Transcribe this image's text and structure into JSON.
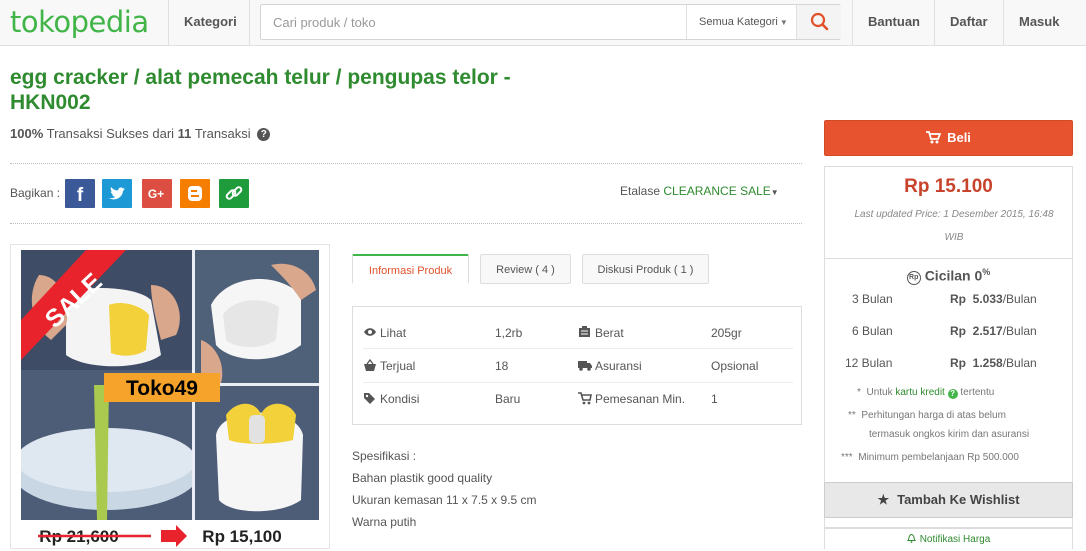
{
  "header": {
    "logo": "tokopedia",
    "kategori": "Kategori",
    "search_placeholder": "Cari produk / toko",
    "search_category": "Semua Kategori",
    "bantuan": "Bantuan",
    "daftar": "Daftar",
    "masuk": "Masuk"
  },
  "product": {
    "title_line1": "egg cracker / alat pemecah telur / pengupas telor -",
    "title_line2": "HKN002",
    "success_pct": "100%",
    "success_text": "Transaksi Sukses dari",
    "success_count": "11",
    "success_suffix": "Transaksi"
  },
  "share": {
    "label": "Bagikan :",
    "etalase_label": "Etalase",
    "etalase_value": "CLEARANCE SALE"
  },
  "image": {
    "sale_text": "SALE",
    "shop_label": "Toko49",
    "old_price": "Rp 21,600",
    "new_price": "Rp 15,100"
  },
  "tabs": {
    "info": "Informasi Produk",
    "review": "Review ( 4 )",
    "diskusi": "Diskusi Produk ( 1 )"
  },
  "info": {
    "lihat_label": "Lihat",
    "lihat_value": "1,2rb",
    "berat_label": "Berat",
    "berat_value": "205gr",
    "terjual_label": "Terjual",
    "terjual_value": "18",
    "asuransi_label": "Asuransi",
    "asuransi_value": "Opsional",
    "kondisi_label": "Kondisi",
    "kondisi_value": "Baru",
    "pemesanan_label": "Pemesanan Min.",
    "pemesanan_value": "1"
  },
  "spec": {
    "heading": "Spesifikasi :",
    "line1": "Bahan plastik good quality",
    "line2": "Ukuran kemasan 11 x 7.5 x 9.5 cm",
    "line3": "Warna putih"
  },
  "purchase": {
    "beli": "Beli",
    "price": "Rp 15.100",
    "updated_line1": "Last updated Price: 1 Desember 2015, 16:48",
    "updated_line2": "WIB",
    "cicilan_title": "Cicilan 0",
    "cicilan_sup": "%",
    "rows": [
      {
        "term": "3 Bulan",
        "rp": "Rp",
        "amount": "5.033",
        "per": "/Bulan"
      },
      {
        "term": "6 Bulan",
        "rp": "Rp",
        "amount": "2.517",
        "per": "/Bulan"
      },
      {
        "term": "12 Bulan",
        "rp": "Rp",
        "amount": "1.258",
        "per": "/Bulan"
      }
    ],
    "note1_star": "*",
    "note1_pre": "Untuk",
    "note1_link": "kartu kredit",
    "note1_post": "tertentu",
    "note2_star": "**",
    "note2_line1": "Perhitungan harga di atas belum",
    "note2_line2": "termasuk ongkos kirim dan asuransi",
    "note3_star": "***",
    "note3_text": "Minimum pembelanjaan Rp 500.000",
    "wishlist": "Tambah Ke Wishlist",
    "notif": "Notifikasi Harga"
  },
  "colors": {
    "brand_green": "#42b549",
    "title_green": "#2f8b2f",
    "buy_orange": "#e7532f",
    "price_red": "#c8432b"
  }
}
